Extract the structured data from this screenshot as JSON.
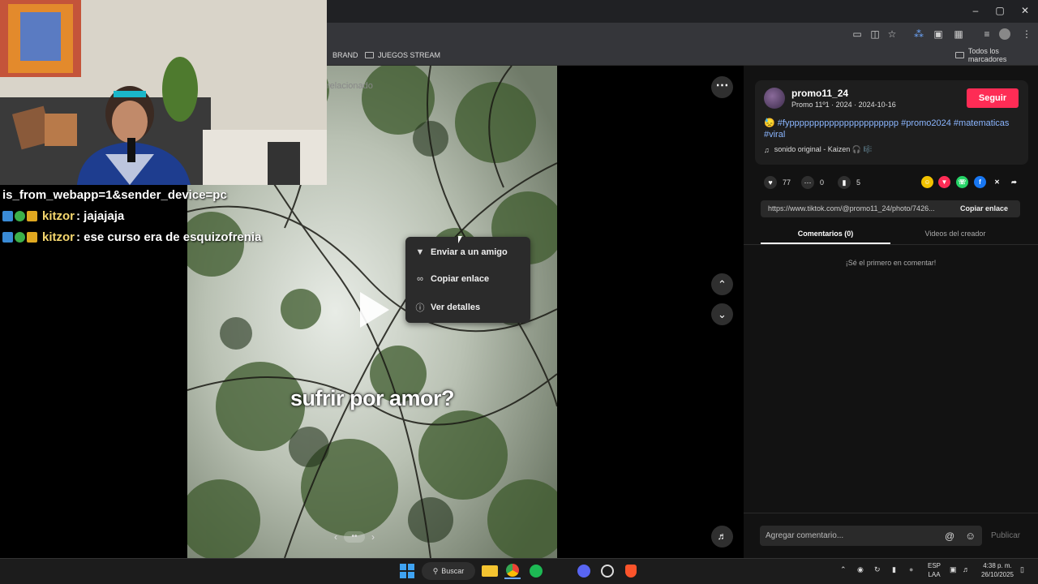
{
  "browser": {
    "bookmarks": [
      "BRAND",
      "JUEGOS STREAM"
    ],
    "all_bookmarks_label": "Todos los marcadores"
  },
  "video": {
    "caption": "sufrir por amor?",
    "search_hint": "relacionado",
    "context_menu": [
      {
        "icon": "send-icon",
        "label": "Enviar a un amigo"
      },
      {
        "icon": "link-icon",
        "label": "Copiar enlace"
      },
      {
        "icon": "info-icon",
        "label": "Ver detalles"
      }
    ]
  },
  "post": {
    "username": "promo11_24",
    "subline": "Promo 11º1 · 2024 · 2024-10-16",
    "follow_label": "Seguir",
    "description_emoji": "😓",
    "description": "#fypppppppppppppppppppppp #promo2024 #matematicas #viral",
    "music": "sonido original - Kaizen 🎧 🎼",
    "likes": "77",
    "comments": "0",
    "saves": "5",
    "link_url": "https://www.tiktok.com/@promo11_24/photo/7426...",
    "copy_link_label": "Copiar enlace",
    "tabs": [
      "Comentarios (0)",
      "Videos del creador"
    ],
    "empty_message": "¡Sé el primero en comentar!",
    "comment_placeholder": "Agregar comentario...",
    "publish_label": "Publicar"
  },
  "chat": {
    "overlay_url_fragment": "is_from_webapp=1&sender_device=pc",
    "messages": [
      {
        "user": "kitzor",
        "text": ": jajajaja"
      },
      {
        "user": "kitzor",
        "text": ": ese curso era de esquizofrenia"
      }
    ]
  },
  "taskbar": {
    "search_label": "Buscar",
    "lang_line1": "ESP",
    "lang_line2": "LAA",
    "time": "4:38 p. m.",
    "date": "26/10/2025"
  },
  "colors": {
    "accent": "#fe2c55",
    "hashtag": "#8bb6ff",
    "chat_user": "#f5d76e"
  }
}
